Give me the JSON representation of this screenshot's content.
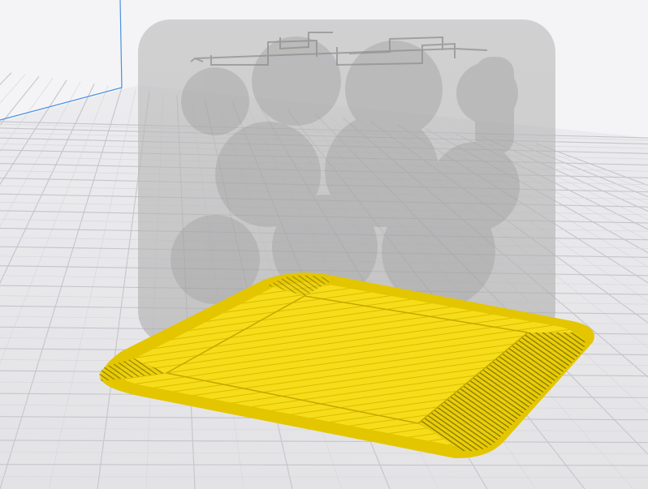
{
  "scene": {
    "view": "3d-viewport",
    "background_color": "#f0f0f2",
    "build_plate_color": "#e9e9ec",
    "grid_major_color": "#c4c4ca",
    "grid_minor_color": "#dcdce0",
    "axis_x_color": "#4a90e2",
    "axis_z_color": "#4a90e2",
    "ghost_model_color": "#9a9a9a",
    "slice_layer_color": "#f5d90a",
    "slice_layer_dark_color": "#8a7700"
  },
  "objects": [
    {
      "name": "ghost-model",
      "kind": "model-outline",
      "state": "transparent"
    },
    {
      "name": "sliced-layer",
      "kind": "layer-preview",
      "state": "visible"
    }
  ]
}
